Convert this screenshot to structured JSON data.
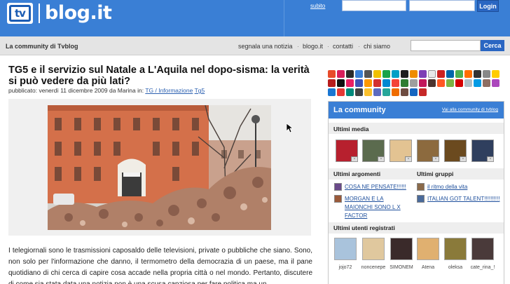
{
  "header": {
    "logo_badge": "tv",
    "logo_text": "blog.it",
    "login_link": "subito",
    "login_button": "Login"
  },
  "navbar": {
    "community_label": "La community di Tvblog",
    "links": [
      "segnala una notizia",
      "blogo.it",
      "contatti",
      "chi siamo"
    ],
    "separator": "·",
    "search_button": "Cerca"
  },
  "article": {
    "title": "TG5 e il servizio sul Natale a L'Aquila nel dopo-sisma: la verità si può vedere da più lati?",
    "meta_prefix": "pubblicato: venerdì 11 dicembre 2009 da Marina in:",
    "category_1": "TG / Informazione",
    "category_2": "Tg5",
    "body": "I telegiornali sono le trasmissioni caposaldo delle televisioni, private o pubbliche che siano. Sono, non solo per l'informazione che danno, il termometro della democrazia di un paese, ma il pane quotidiano di chi cerca di capire cosa accade nella propria città o nel mondo. Pertanto, discutere di come sia stata data una notizia non è una scusa capziosa per fare politica ma un"
  },
  "community": {
    "title": "La community",
    "link": "Vai alla community di tvblog",
    "media_title": "Ultimi media",
    "topics_title": "Ultimi argomenti",
    "groups_title": "Ultimi gruppi",
    "topics": [
      "COSA NE PENSATE!!!!!!",
      "MORGAN E LA MAIONCHI SONO L X FACTOR"
    ],
    "groups": [
      "il ritmo della vita",
      "ITALIAN GOT TALENT!!!!!!!!!!"
    ],
    "users_title": "Ultimi utenti registrati",
    "users": [
      "jojo72",
      "noncenepe",
      "SIMONEM",
      "Atena",
      "oleksa",
      "cate_rina_!"
    ],
    "camera_badge": "▫"
  }
}
